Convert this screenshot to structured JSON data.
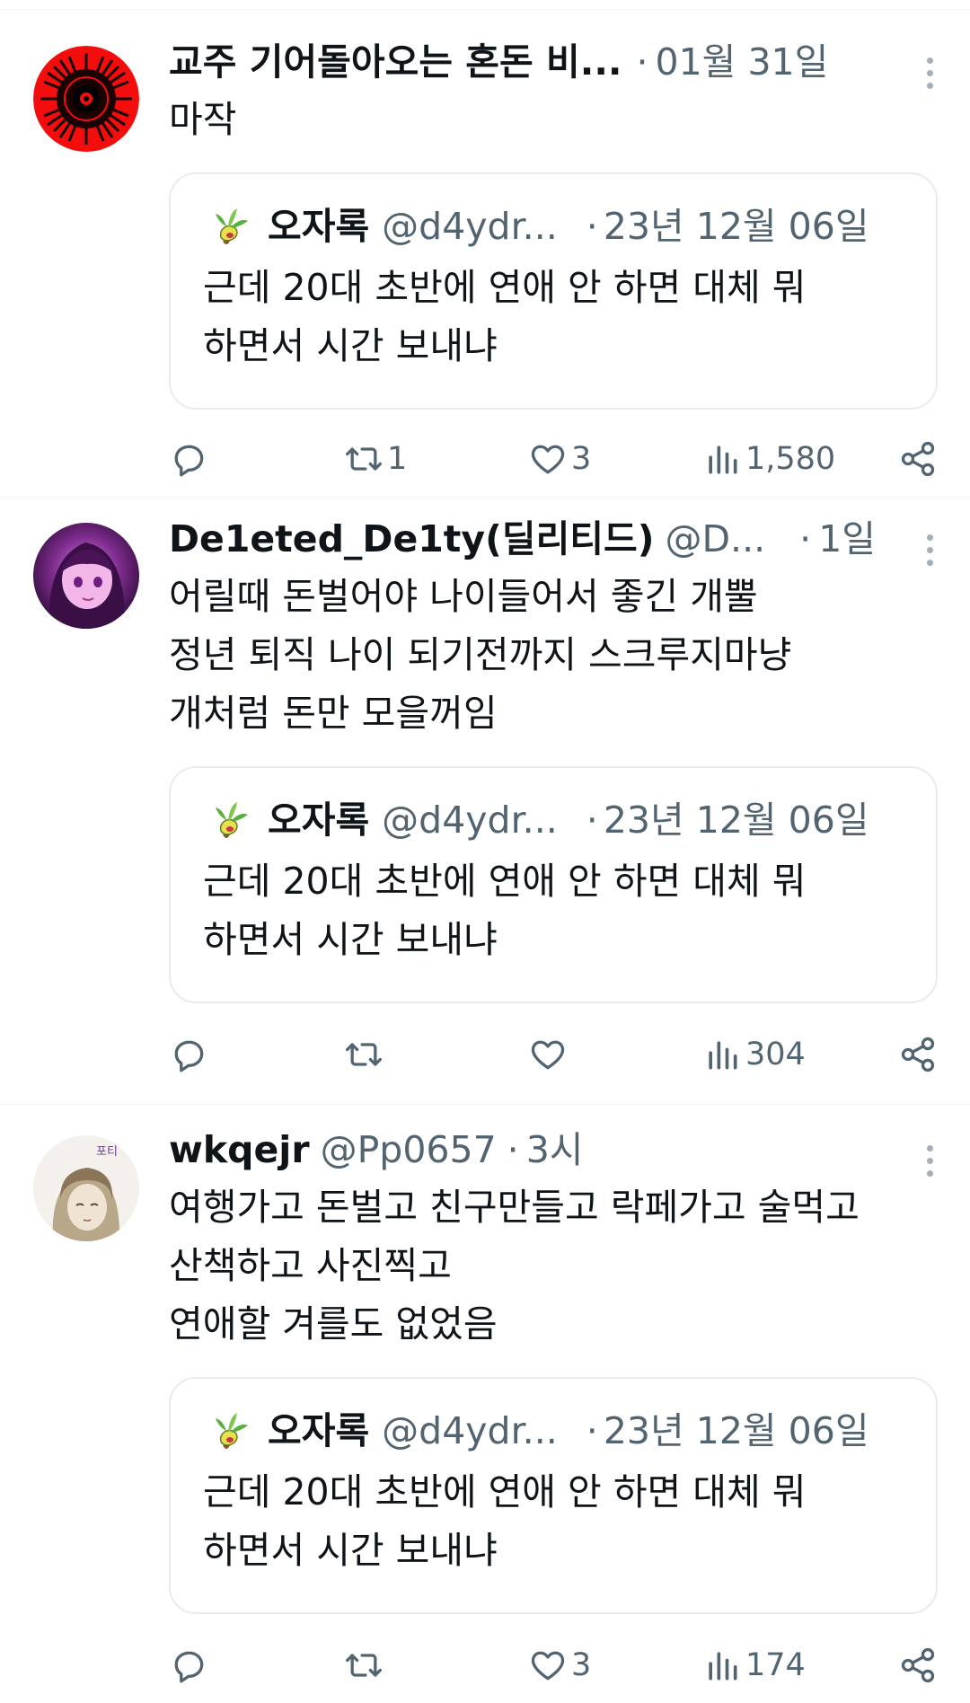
{
  "tweets": [
    {
      "name": "교주 기어돌아오는 혼돈 비...",
      "handle": "",
      "time": "01월 31일",
      "text": "마작",
      "avatar": "black-mandala-on-red-avatar",
      "quote": {
        "name": "오자록",
        "handle": "@d4ydr...",
        "time": "23년 12월 06일",
        "text": "근데 20대 초반에 연애 안 하면 대체 뭐\n하면서 시간 보내냐"
      },
      "stats": {
        "replies": "",
        "retweets": "1",
        "likes": "3",
        "views": "1,580"
      }
    },
    {
      "name": "De1eted_De1ty(딜리티드)",
      "handle": "@D...",
      "time": "1일",
      "text": "어릴때 돈벌어야 나이들어서 좋긴 개뿔\n정년 퇴직 나이 되기전까지 스크루지마냥\n개처럼 돈만 모을꺼임",
      "avatar": "purple-anime-girl-avatar",
      "quote": {
        "name": "오자록",
        "handle": "@d4ydr...",
        "time": "23년 12월 06일",
        "text": "근데 20대 초반에 연애 안 하면 대체 뭐\n하면서 시간 보내냐"
      },
      "stats": {
        "replies": "",
        "retweets": "",
        "likes": "",
        "views": "304"
      }
    },
    {
      "name": "wkqejr",
      "handle": "@Pp0657",
      "time": "3시",
      "text": "여행가고 돈벌고 친구만들고 락페가고 술먹고\n산책하고 사진찍고\n연애할 겨를도 없었음",
      "avatar": "sketch-character-avatar",
      "quote": {
        "name": "오자록",
        "handle": "@d4ydr...",
        "time": "23년 12월 06일",
        "text": "근데 20대 초반에 연애 안 하면 대체 뭐\n하면서 시간 보내냐"
      },
      "stats": {
        "replies": "",
        "retweets": "",
        "likes": "3",
        "views": "174"
      }
    }
  ],
  "separator": "·",
  "icons": {
    "reply": "reply-icon",
    "retweet": "retweet-icon",
    "like": "heart-icon",
    "views": "views-icon",
    "share": "share-icon",
    "more": "more-vertical-icon"
  },
  "colors": {
    "text_primary": "#0f1419",
    "text_secondary": "#536471",
    "divider": "#eff3f4",
    "quote_border": "#e7ecef"
  }
}
